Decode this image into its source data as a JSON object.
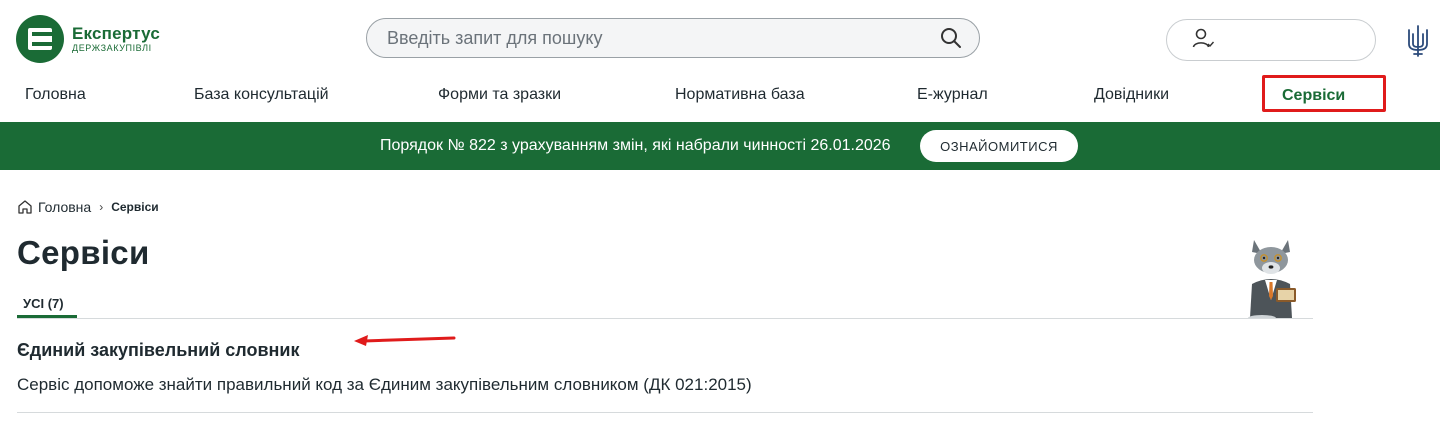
{
  "header": {
    "logo_title": "Експертус",
    "logo_sub": "ДЕРЖЗАКУПІВЛІ",
    "search_placeholder": "Введіть запит для пошуку"
  },
  "nav": {
    "items": [
      "Головна",
      "База консультацій",
      "Форми та зразки",
      "Нормативна база",
      "Е-журнал",
      "Довідники"
    ],
    "active": "Сервіси"
  },
  "banner": {
    "text": "Порядок № 822 з урахуванням змін, які набрали чинності 26.01.2026",
    "button": "ОЗНАЙОМИТИСЯ"
  },
  "breadcrumb": {
    "home": "Головна",
    "separator": "›",
    "current": "Сервіси"
  },
  "page": {
    "title": "Сервіси",
    "tab": "УСІ (7)"
  },
  "service": {
    "title": "Єдиний закупівельний словник",
    "description": "Сервіс допоможе знайти правильний код за Єдиним закупівельним словником (ДК 021:2015)"
  },
  "colors": {
    "brand_green": "#1a6b36",
    "highlight_red": "#e01b1b"
  }
}
